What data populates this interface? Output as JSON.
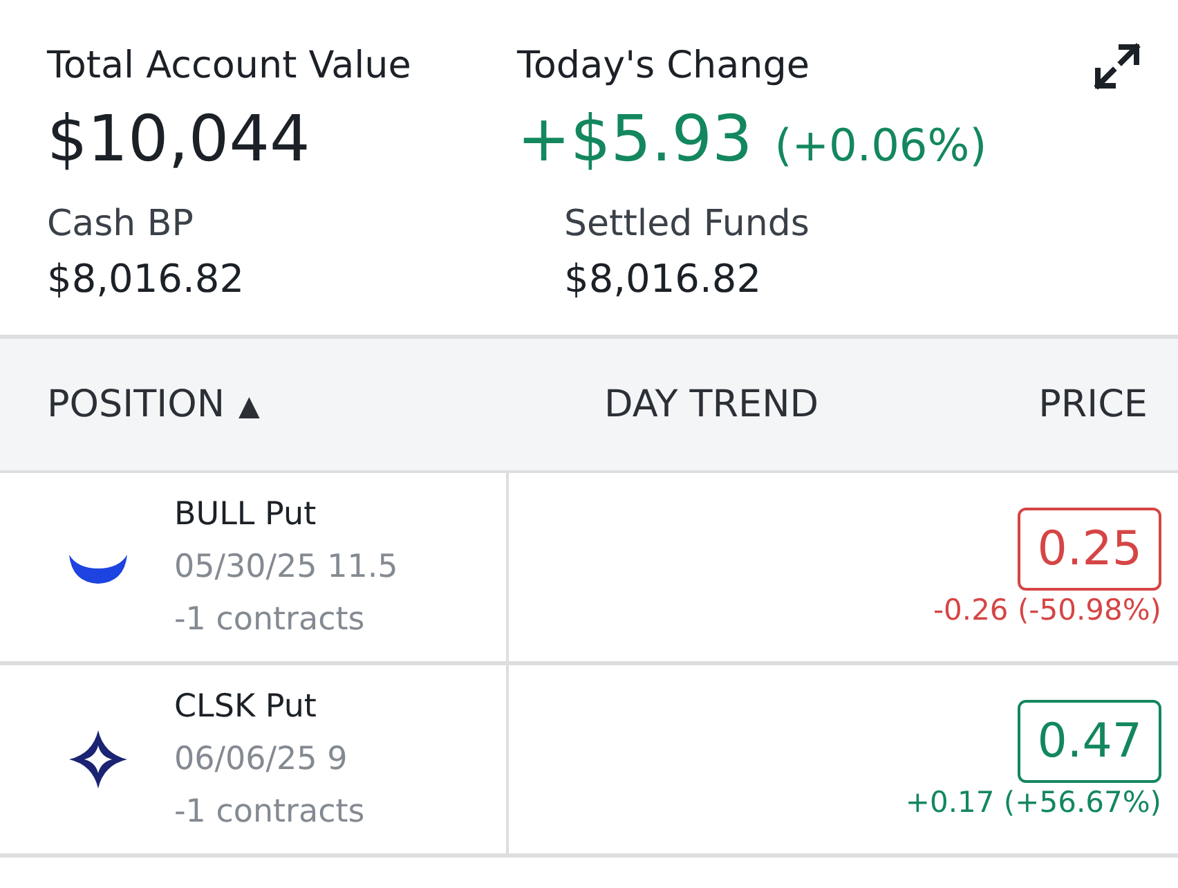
{
  "summary": {
    "total_label": "Total Account Value",
    "total_value": "$10,044",
    "change_label": "Today's Change",
    "change": {
      "value": "+$5.93",
      "percent": "(+0.06%)",
      "color": "#13875d"
    },
    "cash_label": "Cash BP",
    "cash_value": "$8,016.82",
    "settled_label": "Settled Funds",
    "settled_value": "$8,016.82"
  },
  "table": {
    "columns": [
      {
        "label": "POSITION",
        "sort": "▲"
      },
      {
        "label": "DAY TREND"
      },
      {
        "label": "PRICE"
      }
    ],
    "rows": [
      {
        "kind": "crescent",
        "name": "BULL Put",
        "detail": "05/30/25 11.5",
        "quantity": "-1 contracts",
        "price": "0.25",
        "change": "-0.26 (-50.98%)",
        "color": "#d64545"
      },
      {
        "kind": "star",
        "name": "CLSK Put",
        "detail": "06/06/25 9",
        "quantity": "-1 contracts",
        "price": "0.47",
        "change": "+0.17 (+56.67%)",
        "color": "#13875d"
      }
    ]
  }
}
